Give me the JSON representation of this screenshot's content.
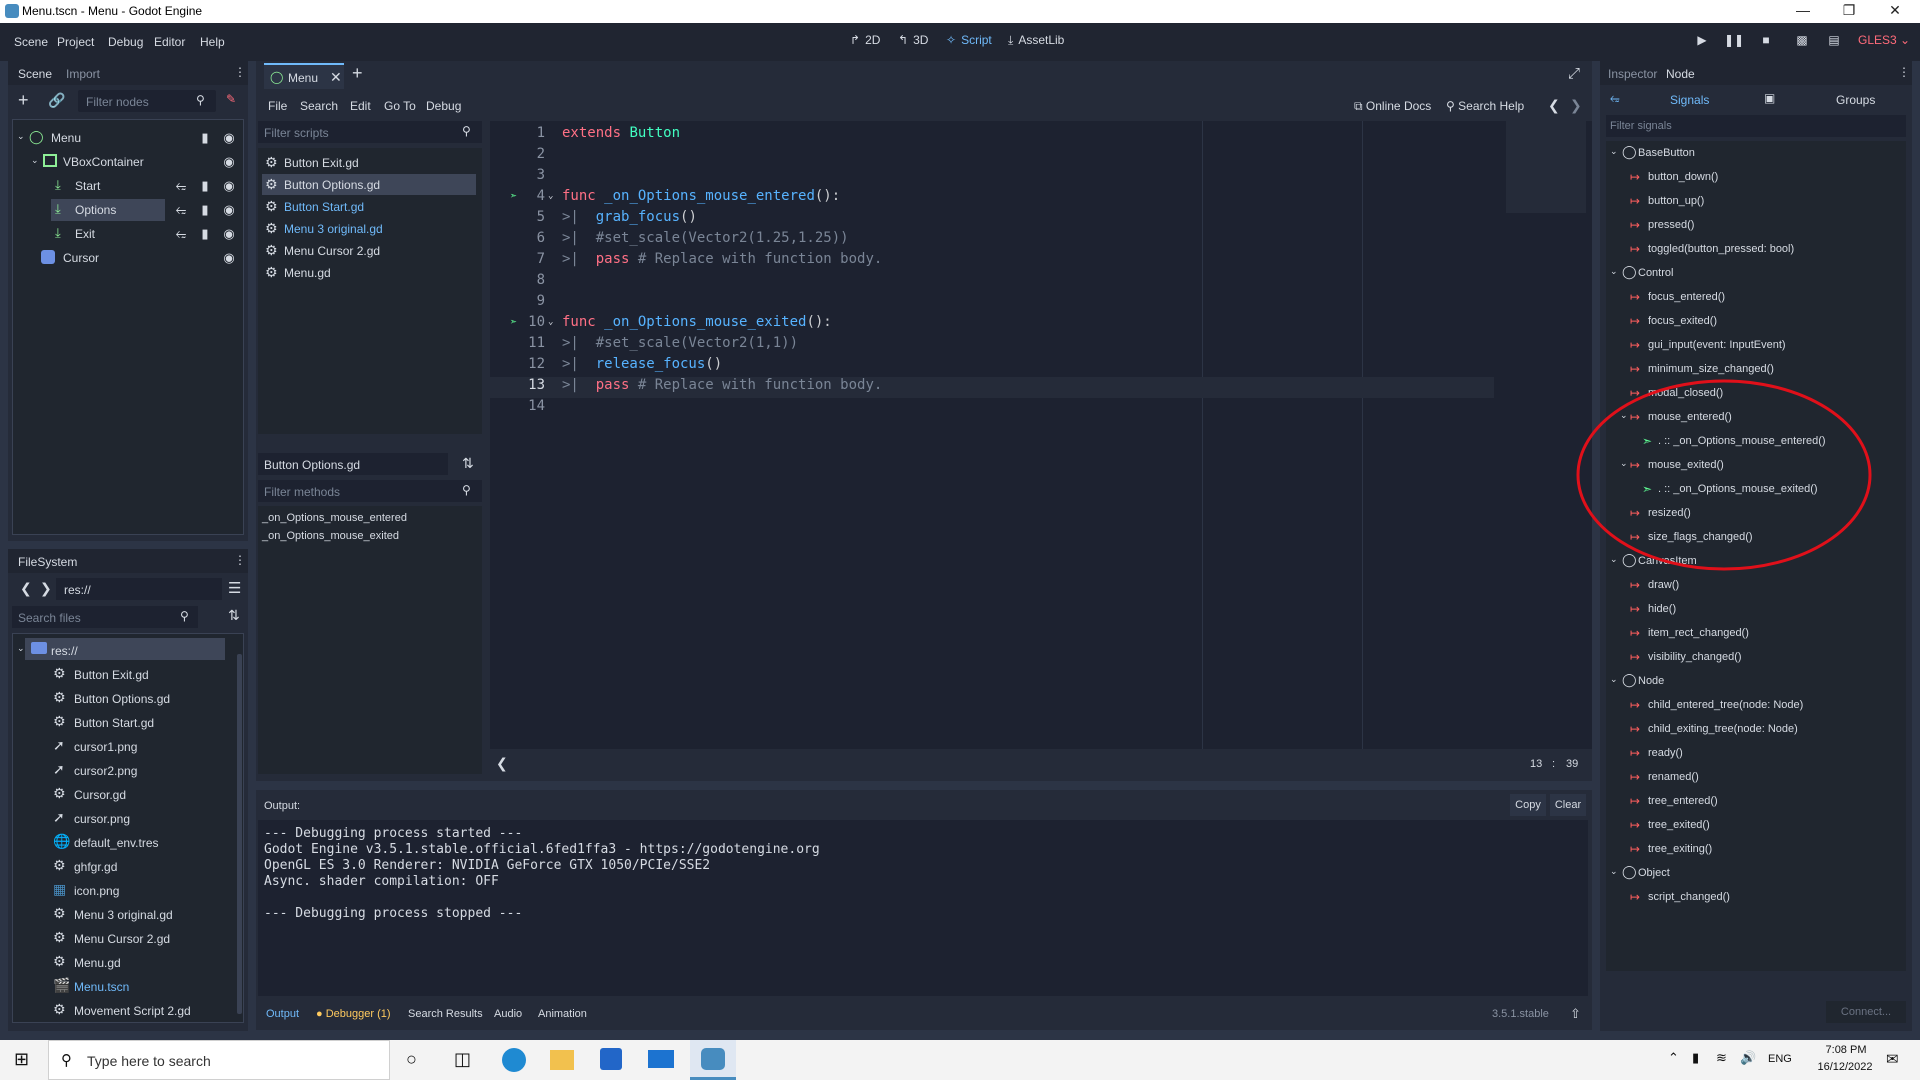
{
  "window": {
    "title": "Menu.tscn - Menu - Godot Engine"
  },
  "menu": [
    "Scene",
    "Project",
    "Debug",
    "Editor",
    "Help"
  ],
  "workspaces": [
    {
      "label": "2D",
      "icon": "2d-icon"
    },
    {
      "label": "3D",
      "icon": "3d-icon"
    },
    {
      "label": "Script",
      "icon": "script-icon",
      "active": true
    },
    {
      "label": "AssetLib",
      "icon": "assetlib-icon"
    }
  ],
  "renderer": "GLES3",
  "scene_dock": {
    "tabs": [
      "Scene",
      "Import"
    ],
    "filter_placeholder": "Filter nodes",
    "nodes": [
      {
        "label": "Menu",
        "depth": 0
      },
      {
        "label": "VBoxContainer",
        "depth": 1
      },
      {
        "label": "Start",
        "depth": 2
      },
      {
        "label": "Options",
        "depth": 2,
        "selected": true
      },
      {
        "label": "Exit",
        "depth": 2
      },
      {
        "label": "Cursor",
        "depth": 1
      }
    ]
  },
  "filesystem": {
    "title": "FileSystem",
    "path": "res://",
    "search_placeholder": "Search files",
    "root": "res://",
    "files": [
      "Button Exit.gd",
      "Button Options.gd",
      "Button Start.gd",
      "cursor1.png",
      "cursor2.png",
      "Cursor.gd",
      "cursor.png",
      "default_env.tres",
      "ghfgr.gd",
      "icon.png",
      "Menu 3 original.gd",
      "Menu Cursor 2.gd",
      "Menu.gd",
      "Menu.tscn",
      "Movement Script 2.gd"
    ]
  },
  "editor": {
    "tab_label": "Menu",
    "script_menu": [
      "File",
      "Search",
      "Edit",
      "Go To",
      "Debug"
    ],
    "online_docs": "Online Docs",
    "search_help": "Search Help",
    "filter_scripts_placeholder": "Filter scripts",
    "scripts": [
      "Button Exit.gd",
      "Button Options.gd",
      "Button Start.gd",
      "Menu 3 original.gd",
      "Menu Cursor 2.gd",
      "Menu.gd"
    ],
    "current_script": "Button Options.gd",
    "filter_methods_placeholder": "Filter methods",
    "methods": [
      "_on_Options_mouse_entered",
      "_on_Options_mouse_exited"
    ],
    "code_lines": [
      "extends Button",
      "",
      "",
      "func _on_Options_mouse_entered():",
      "grab_focus()",
      "#set_scale(Vector2(1.25,1.25))",
      "pass # Replace with function body.",
      "",
      "",
      "func _on_Options_mouse_exited():",
      "#set_scale(Vector2(1,1))",
      "release_focus()",
      "pass # Replace with function body.",
      ""
    ],
    "cursor_line": "13",
    "cursor_col": "39"
  },
  "output": {
    "label": "Output:",
    "copy": "Copy",
    "clear": "Clear",
    "lines": [
      "--- Debugging process started ---",
      "Godot Engine v3.5.1.stable.official.6fed1ffa3 - https://godotengine.org",
      "OpenGL ES 3.0 Renderer: NVIDIA GeForce GTX 1050/PCIe/SSE2",
      "Async. shader compilation: OFF",
      "",
      "--- Debugging process stopped ---"
    ]
  },
  "bottom_tabs": [
    "Output",
    "Debugger (1)",
    "Search Results",
    "Audio",
    "Animation"
  ],
  "version": "3.5.1.stable",
  "node_dock": {
    "tabs": [
      "Inspector",
      "Node"
    ],
    "subtabs": [
      "Signals",
      "Groups"
    ],
    "filter_placeholder": "Filter signals",
    "connect": "Connect...",
    "items": [
      {
        "kind": "class",
        "label": "BaseButton"
      },
      {
        "kind": "signal",
        "label": "button_down()"
      },
      {
        "kind": "signal",
        "label": "button_up()"
      },
      {
        "kind": "signal",
        "label": "pressed()"
      },
      {
        "kind": "signal",
        "label": "toggled(button_pressed: bool)"
      },
      {
        "kind": "class",
        "label": "Control"
      },
      {
        "kind": "signal",
        "label": "focus_entered()"
      },
      {
        "kind": "signal",
        "label": "focus_exited()"
      },
      {
        "kind": "signal",
        "label": "gui_input(event: InputEvent)"
      },
      {
        "kind": "signal",
        "label": "minimum_size_changed()"
      },
      {
        "kind": "signal",
        "label": "modal_closed()"
      },
      {
        "kind": "signal-open",
        "label": "mouse_entered()"
      },
      {
        "kind": "conn",
        "label": ". :: _on_Options_mouse_entered()"
      },
      {
        "kind": "signal-open",
        "label": "mouse_exited()"
      },
      {
        "kind": "conn",
        "label": ". :: _on_Options_mouse_exited()"
      },
      {
        "kind": "signal",
        "label": "resized()"
      },
      {
        "kind": "signal",
        "label": "size_flags_changed()"
      },
      {
        "kind": "class",
        "label": "CanvasItem"
      },
      {
        "kind": "signal",
        "label": "draw()"
      },
      {
        "kind": "signal",
        "label": "hide()"
      },
      {
        "kind": "signal",
        "label": "item_rect_changed()"
      },
      {
        "kind": "signal",
        "label": "visibility_changed()"
      },
      {
        "kind": "class",
        "label": "Node"
      },
      {
        "kind": "signal",
        "label": "child_entered_tree(node: Node)"
      },
      {
        "kind": "signal",
        "label": "child_exiting_tree(node: Node)"
      },
      {
        "kind": "signal",
        "label": "ready()"
      },
      {
        "kind": "signal",
        "label": "renamed()"
      },
      {
        "kind": "signal",
        "label": "tree_entered()"
      },
      {
        "kind": "signal",
        "label": "tree_exited()"
      },
      {
        "kind": "signal",
        "label": "tree_exiting()"
      },
      {
        "kind": "class",
        "label": "Object"
      },
      {
        "kind": "signal",
        "label": "script_changed()"
      }
    ]
  },
  "taskbar": {
    "search_placeholder": "Type here to search",
    "lang": "ENG",
    "time": "7:08 PM",
    "date": "16/12/2022"
  },
  "colors": {
    "accent": "#70bafa",
    "annotation": "#e0101a",
    "signal": "#ff5f5f",
    "connection": "#5fff95"
  }
}
